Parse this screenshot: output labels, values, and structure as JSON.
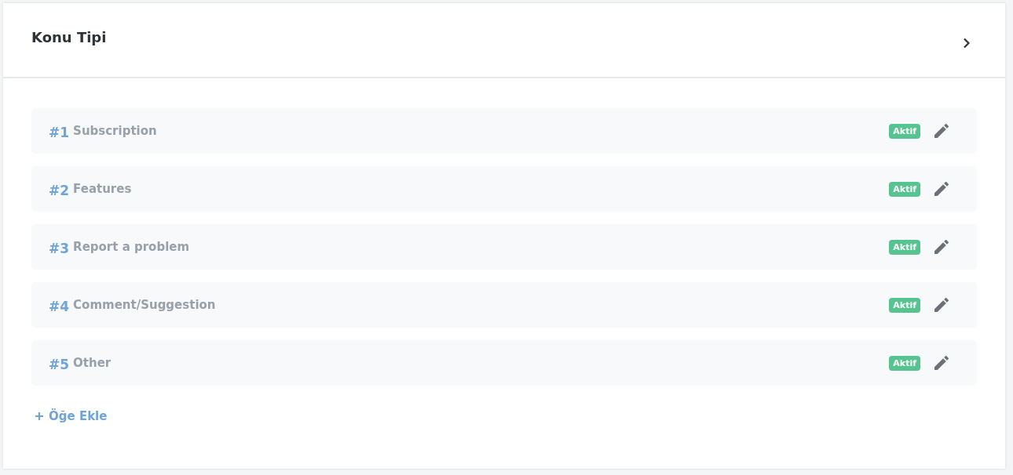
{
  "panel": {
    "title": "Konu Tipi"
  },
  "items": [
    {
      "number": "#1",
      "label": "Subscription",
      "status": "Aktif",
      "active": true
    },
    {
      "number": "#2",
      "label": "Features",
      "status": "Aktif",
      "active": true
    },
    {
      "number": "#3",
      "label": "Report a problem",
      "status": "Aktif",
      "active": true
    },
    {
      "number": "#4",
      "label": "Comment/Suggestion",
      "status": "Aktif",
      "active": true
    },
    {
      "number": "#5",
      "label": "Other",
      "status": "Aktif",
      "active": true
    }
  ],
  "add_link": "Öğe Ekle"
}
